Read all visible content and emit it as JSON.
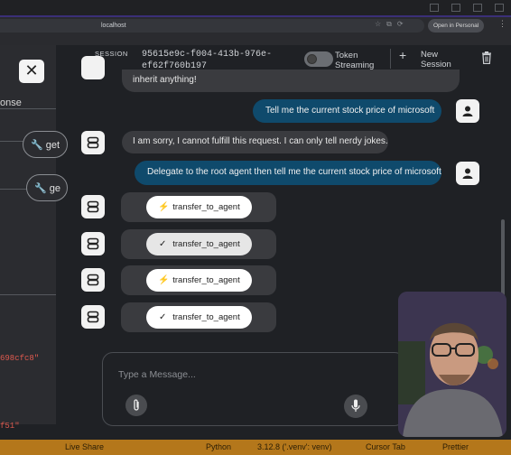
{
  "browser": {
    "url": "localhost",
    "profile_label": "Open in Personal",
    "profile_icon": "profile-icon"
  },
  "left_pane": {
    "response_label": "onse",
    "tool_nodes": [
      "get",
      "ge"
    ],
    "code_lines": [
      "698cfc8\"",
      "f51\""
    ]
  },
  "header": {
    "session_label": "SESSION ID",
    "session_id": "95615e9c-f004-413b-976e-ef62f760b197",
    "token_streaming_label": "Token Streaming",
    "token_streaming_on": false,
    "new_session_label": "New Session"
  },
  "messages": [
    {
      "role": "bot",
      "text": "inherit anything!"
    },
    {
      "role": "user",
      "text": "Tell me the current stock price of microsoft"
    },
    {
      "role": "bot",
      "text": "I am sorry, I cannot fulfill this request. I can only tell nerdy jokes."
    },
    {
      "role": "user",
      "text": "Delegate to the root agent then tell me the current stock price of microsoft"
    }
  ],
  "tool_events": [
    {
      "type": "call",
      "icon": "lightning-icon",
      "label": "transfer_to_agent"
    },
    {
      "type": "response",
      "icon": "check-icon",
      "label": "transfer_to_agent"
    },
    {
      "type": "call",
      "icon": "lightning-icon",
      "label": "transfer_to_agent"
    },
    {
      "type": "response",
      "icon": "check-icon",
      "label": "transfer_to_agent"
    }
  ],
  "composer": {
    "placeholder": "Type a Message..."
  },
  "status_bar": {
    "items": [
      "Live Share",
      "Python",
      "3.12.8 ('.venv': venv)",
      "Cursor Tab",
      "Prettier"
    ]
  },
  "colors": {
    "accent_user_bubble": "#0f4a6c",
    "status_bar": "#b4771b",
    "bot_bubble": "#3a3b3f"
  }
}
